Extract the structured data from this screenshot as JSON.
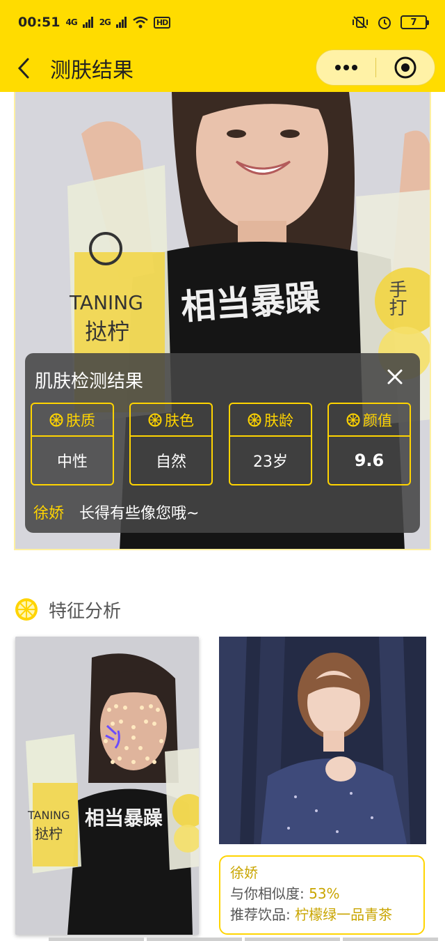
{
  "status_bar": {
    "time": "00:51",
    "network_left": "4G",
    "network_right": "2G",
    "hd_label": "HD",
    "battery": "7"
  },
  "nav": {
    "title": "测肤结果",
    "more_icon": "ellipsis-icon",
    "close_icon": "target-circle-icon"
  },
  "hero": {
    "shirt_text": "相当暴躁",
    "bag_brand_en": "TANING",
    "bag_brand_cn": "挞柠",
    "bag_right_text": "手打"
  },
  "result_panel": {
    "title": "肌肤检测结果",
    "metrics": [
      {
        "label": "肤质",
        "value": "中性"
      },
      {
        "label": "肤色",
        "value": "自然"
      },
      {
        "label": "肤龄",
        "value": "23岁"
      },
      {
        "label": "颜值",
        "value": "9.6"
      }
    ],
    "lookalike_name": "徐娇",
    "lookalike_text": "长得有些像您哦~"
  },
  "feature_section": {
    "title": "特征分析",
    "card": {
      "name": "徐娇",
      "similarity_label": "与你相似度: ",
      "similarity_value": "53%",
      "drink_label": "推荐饮品: ",
      "drink_value": "柠檬绿一品青茶"
    }
  },
  "colors": {
    "accent": "#ffdc00",
    "gold": "#ffd400",
    "panel_bg": "#464646"
  }
}
